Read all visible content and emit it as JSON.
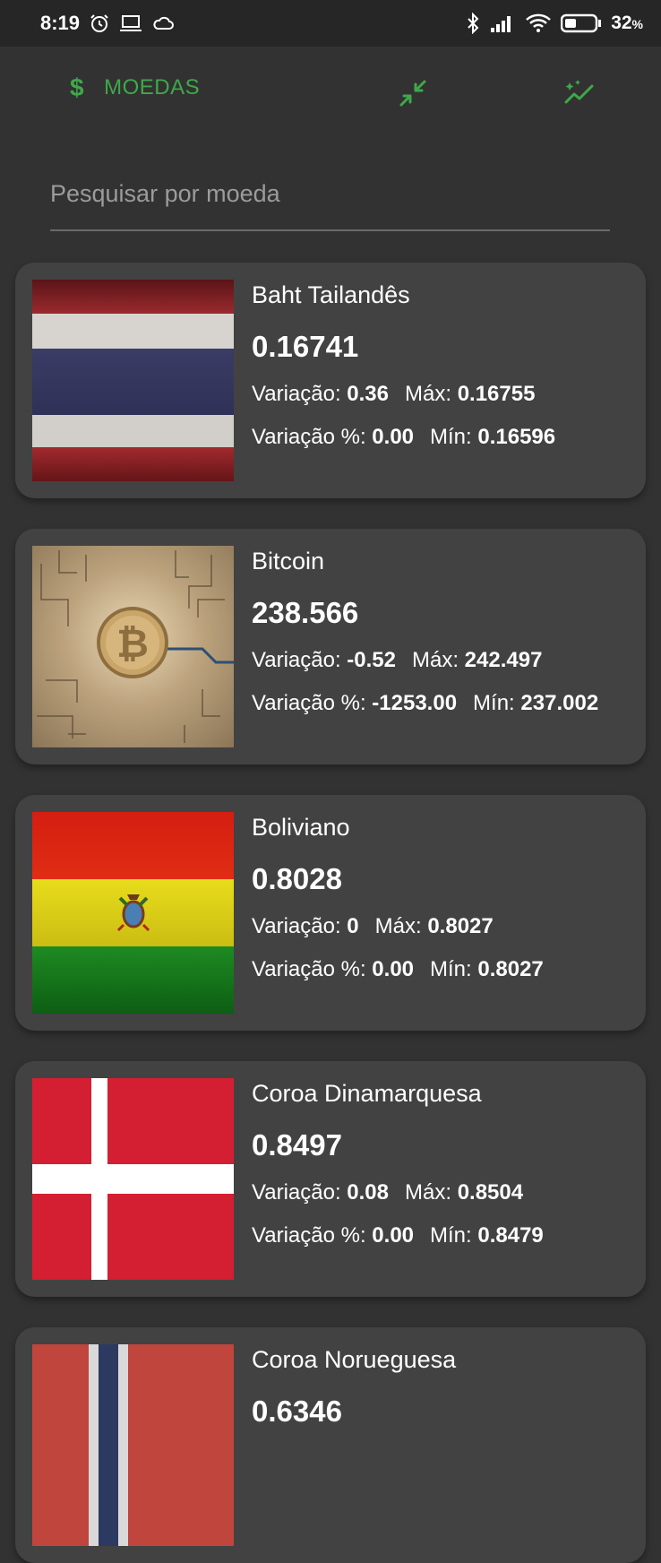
{
  "status_bar": {
    "time": "8:19",
    "battery_percent": "32",
    "battery_unit": "%",
    "icons_left": [
      "alarm-icon",
      "laptop-icon",
      "cloud-icon"
    ],
    "icons_right": [
      "bluetooth-icon",
      "signal-icon",
      "wifi-icon",
      "battery-icon"
    ]
  },
  "app_bar": {
    "tab_moedas_symbol": "$",
    "tab_moedas_label": "MOEDAS",
    "accent_color": "#3fa84a",
    "icons": [
      "compare-arrows-icon",
      "trending-sparkle-icon"
    ]
  },
  "search": {
    "placeholder": "Pesquisar por moeda",
    "value": ""
  },
  "labels": {
    "variacao": "Variação:",
    "variacao_pct": "Variação %:",
    "max": "Máx:",
    "min": "Mín:"
  },
  "currencies": [
    {
      "name": "Baht Tailandês",
      "price": "0.16741",
      "variacao": "0.36",
      "max": "0.16755",
      "variacao_pct": "0.00",
      "min": "0.16596",
      "image": "thailand-flag"
    },
    {
      "name": "Bitcoin",
      "price": "238.566",
      "variacao": "-0.52",
      "max": "242.497",
      "variacao_pct": "-1253.00",
      "min": "237.002",
      "image": "bitcoin-coin"
    },
    {
      "name": "Boliviano",
      "price": "0.8028",
      "variacao": "0",
      "max": "0.8027",
      "variacao_pct": "0.00",
      "min": "0.8027",
      "image": "bolivia-flag"
    },
    {
      "name": "Coroa Dinamarquesa",
      "price": "0.8497",
      "variacao": "0.08",
      "max": "0.8504",
      "variacao_pct": "0.00",
      "min": "0.8479",
      "image": "denmark-flag"
    },
    {
      "name": "Coroa Norueguesa",
      "price": "0.6346",
      "image": "norway-flag"
    }
  ]
}
